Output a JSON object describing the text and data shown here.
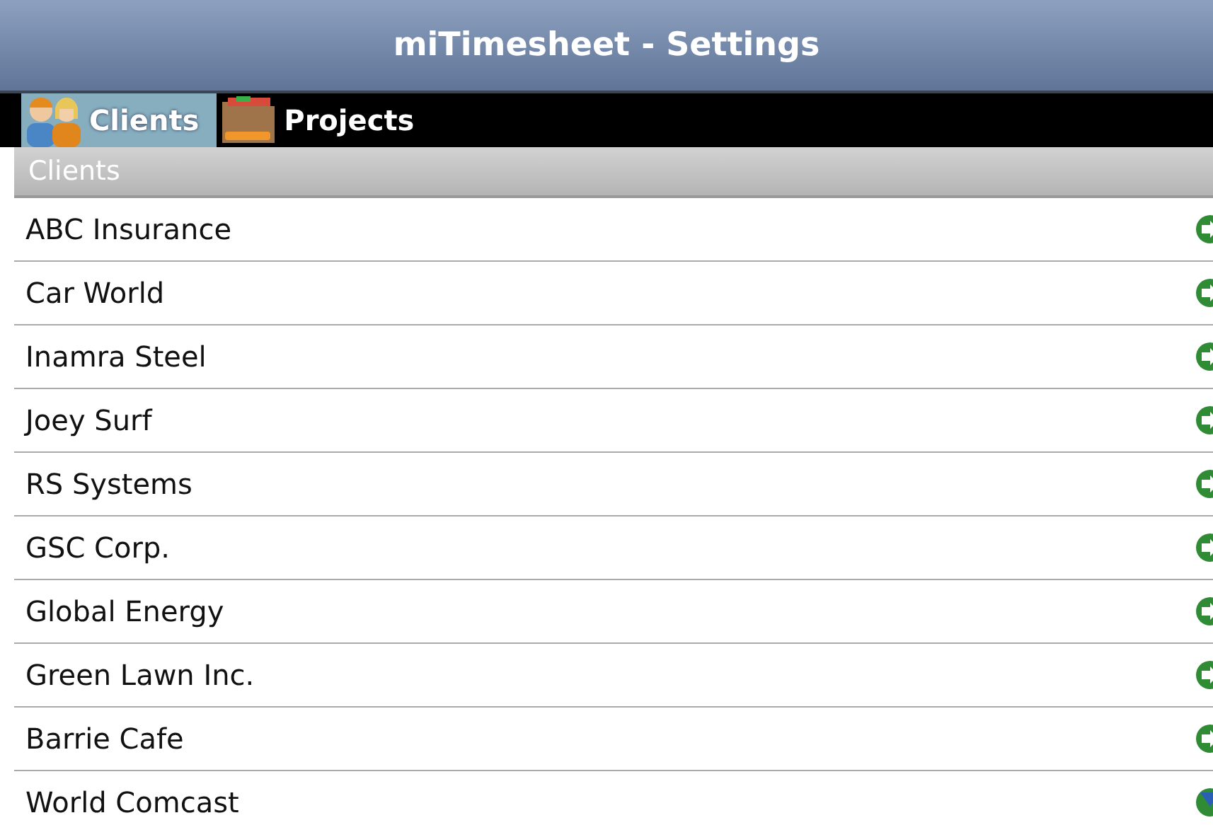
{
  "window": {
    "title": "miTimesheet - Settings"
  },
  "tabs": [
    {
      "label": "Clients",
      "kind": "people",
      "selected": true
    },
    {
      "label": "Projects",
      "kind": "folder",
      "selected": false
    }
  ],
  "section": {
    "title": "Clients"
  },
  "clients": [
    {
      "name": "ABC Insurance",
      "kind": "arrow"
    },
    {
      "name": "Car World",
      "kind": "arrow"
    },
    {
      "name": "Inamra Steel",
      "kind": "arrow"
    },
    {
      "name": "Joey Surf",
      "kind": "arrow"
    },
    {
      "name": "RS Systems",
      "kind": "arrow"
    },
    {
      "name": "GSC Corp.",
      "kind": "arrow"
    },
    {
      "name": "Global Energy",
      "kind": "arrow"
    },
    {
      "name": "Green Lawn Inc.",
      "kind": "arrow"
    },
    {
      "name": "Barrie Cafe",
      "kind": "arrow"
    },
    {
      "name": "World Comcast",
      "kind": "down"
    }
  ]
}
